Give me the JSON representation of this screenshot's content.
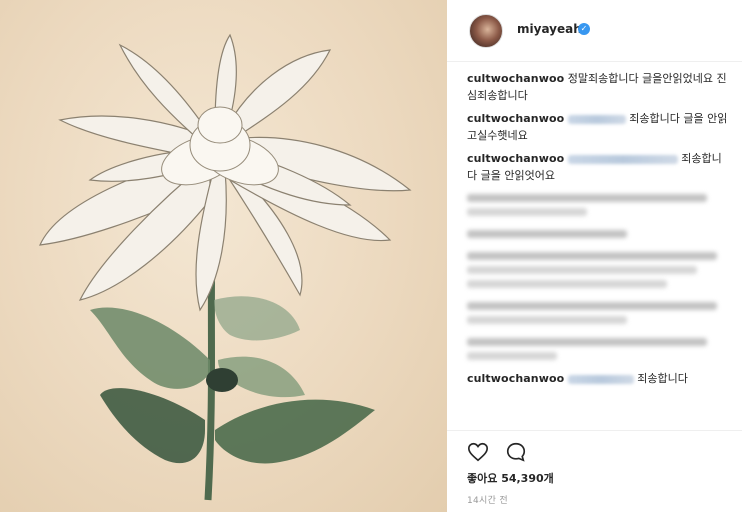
{
  "post": {
    "username": "miyayeah",
    "verified_icon": "verified-badge-icon",
    "likes_text": "좋아요 54,390개",
    "time_text": "14시간 전"
  },
  "comments": [
    {
      "user": "cultwochanwoo",
      "text": "정말죄송합니다 글을안읽었네요 진심죄송합니다"
    },
    {
      "user": "cultwochanwoo",
      "text": "죄송합니다 글을 안읽고실수햇네요"
    },
    {
      "user": "cultwochanwoo",
      "text": "죄송합니다 글을 안읽엇어요"
    },
    {
      "user": "cultwochanwoo",
      "text": "죄송합니다"
    }
  ],
  "icons": {
    "like": "heart-icon",
    "comment": "comment-icon"
  },
  "colors": {
    "accent": "#3897f0",
    "text": "#262626",
    "muted": "#999999"
  }
}
